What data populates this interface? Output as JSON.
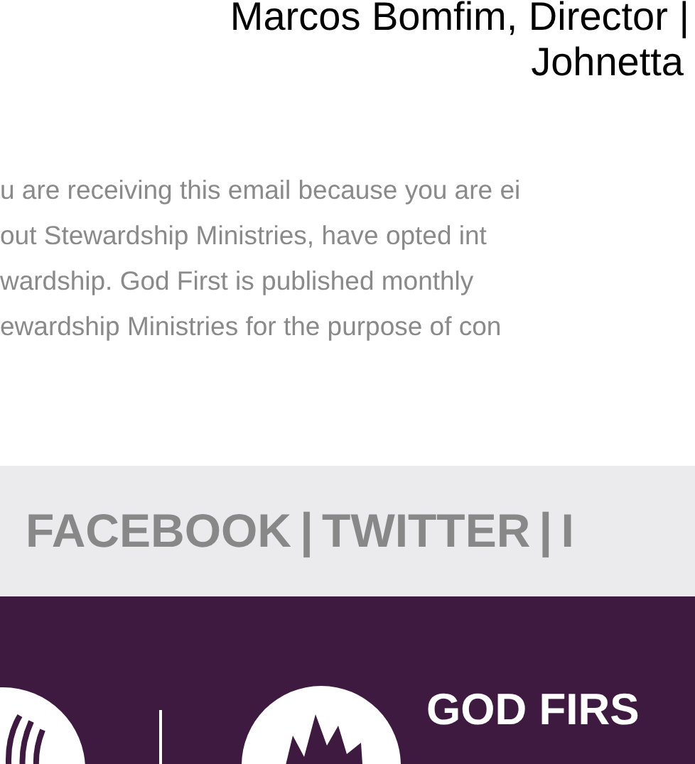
{
  "signature": {
    "line_1": "Marcos Bomfim, Director |",
    "line_2": "Johnetta"
  },
  "disclaimer": {
    "lines": [
      "u are receiving this email because you are ei",
      "out Stewardship Ministries, have opted int",
      "wardship. God First is published monthly",
      "ewardship Ministries for the purpose of con"
    ]
  },
  "social_links": {
    "separator": "|",
    "links": [
      "FACEBOOK",
      "TWITTER",
      "I"
    ]
  },
  "footer": {
    "logo_text": "GOD FIRS"
  }
}
